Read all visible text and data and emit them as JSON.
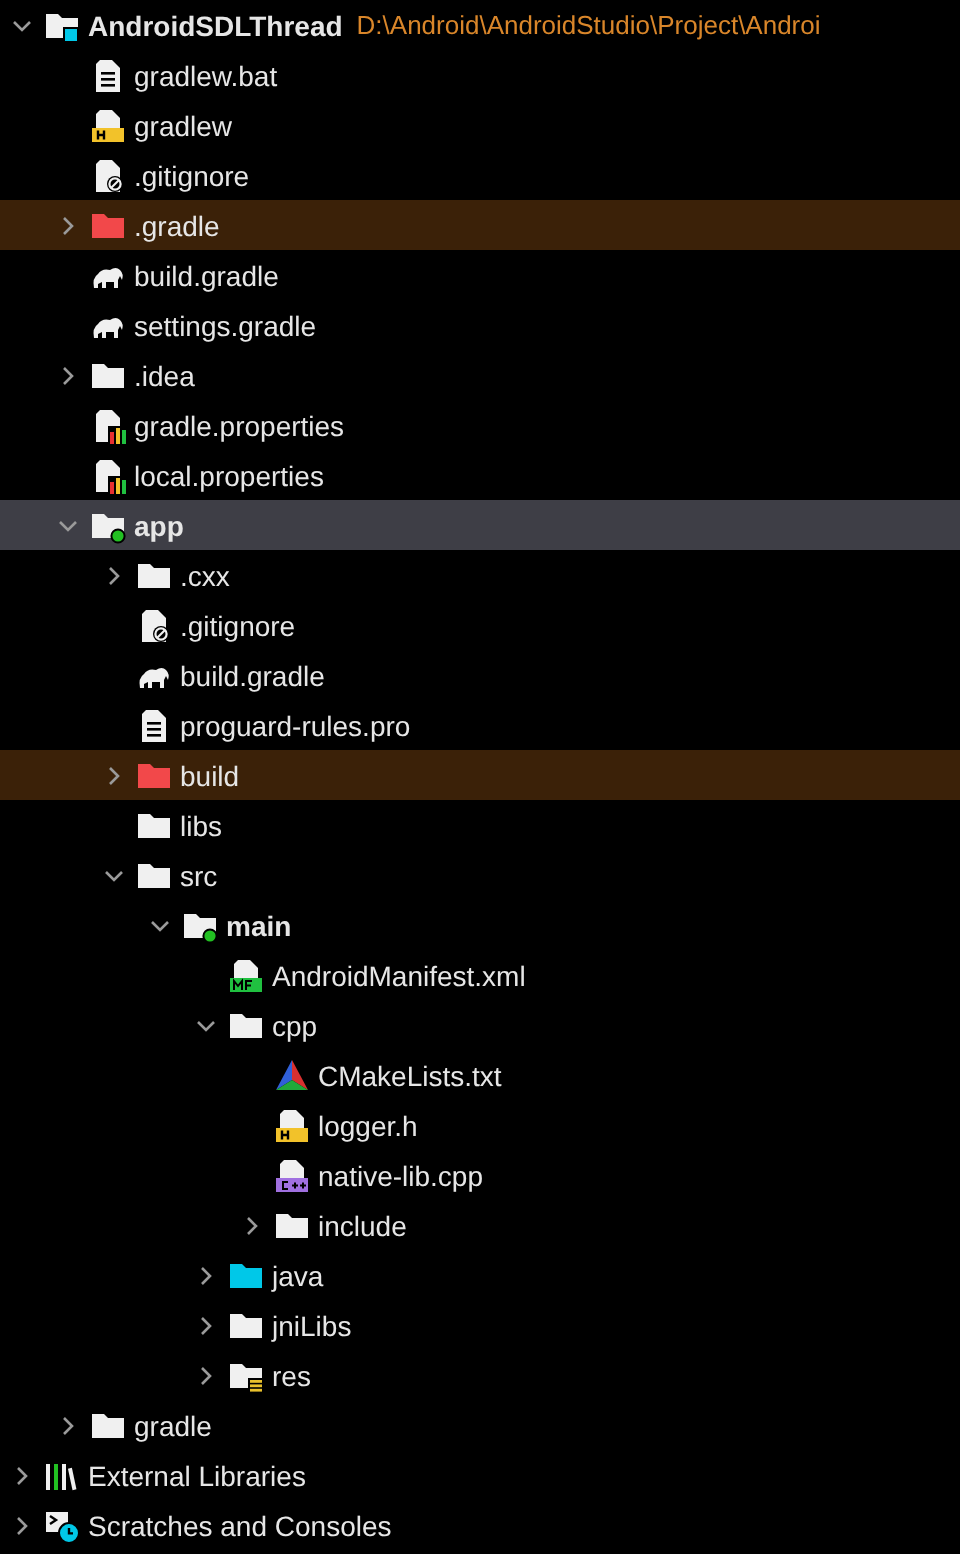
{
  "tree": [
    {
      "label": "AndroidSDLThread",
      "path": "D:\\Android\\AndroidStudio\\Project\\Androi",
      "kind": "project",
      "expanded": true,
      "selected": false,
      "excluded": false,
      "children": [
        {
          "label": "gradlew.bat",
          "kind": "text",
          "selected": false,
          "excluded": false
        },
        {
          "label": "gradlew",
          "kind": "shell",
          "selected": false,
          "excluded": false
        },
        {
          "label": ".gitignore",
          "kind": "ignore",
          "selected": false,
          "excluded": false
        },
        {
          "label": ".gradle",
          "kind": "folder",
          "expanded": false,
          "selected": false,
          "excluded": true
        },
        {
          "label": "build.gradle",
          "kind": "gradle",
          "selected": false,
          "excluded": false
        },
        {
          "label": "settings.gradle",
          "kind": "gradle",
          "selected": false,
          "excluded": false
        },
        {
          "label": ".idea",
          "kind": "folder",
          "expanded": false,
          "selected": false,
          "excluded": false
        },
        {
          "label": "gradle.properties",
          "kind": "properties",
          "selected": false,
          "excluded": false
        },
        {
          "label": "local.properties",
          "kind": "properties",
          "selected": false,
          "excluded": false
        },
        {
          "label": "app",
          "kind": "module",
          "expanded": true,
          "selected": true,
          "excluded": false,
          "children": [
            {
              "label": ".cxx",
              "kind": "folder",
              "expanded": false,
              "selected": false,
              "excluded": false
            },
            {
              "label": ".gitignore",
              "kind": "ignore",
              "selected": false,
              "excluded": false
            },
            {
              "label": "build.gradle",
              "kind": "gradle",
              "selected": false,
              "excluded": false
            },
            {
              "label": "proguard-rules.pro",
              "kind": "text",
              "selected": false,
              "excluded": false
            },
            {
              "label": "build",
              "kind": "folder",
              "expanded": false,
              "selected": false,
              "excluded": true
            },
            {
              "label": "libs",
              "kind": "folder",
              "selected": false,
              "excluded": false
            },
            {
              "label": "src",
              "kind": "folder",
              "expanded": true,
              "selected": false,
              "excluded": false,
              "children": [
                {
                  "label": "main",
                  "kind": "module",
                  "expanded": true,
                  "selected": false,
                  "excluded": false,
                  "children": [
                    {
                      "label": "AndroidManifest.xml",
                      "kind": "manifest",
                      "selected": false,
                      "excluded": false
                    },
                    {
                      "label": "cpp",
                      "kind": "folder",
                      "expanded": true,
                      "selected": false,
                      "excluded": false,
                      "children": [
                        {
                          "label": "CMakeLists.txt",
                          "kind": "cmake",
                          "selected": false,
                          "excluded": false
                        },
                        {
                          "label": "logger.h",
                          "kind": "header",
                          "selected": false,
                          "excluded": false
                        },
                        {
                          "label": "native-lib.cpp",
                          "kind": "cpp",
                          "selected": false,
                          "excluded": false
                        },
                        {
                          "label": "include",
                          "kind": "folder",
                          "expanded": false,
                          "selected": false,
                          "excluded": false
                        }
                      ]
                    },
                    {
                      "label": "java",
                      "kind": "source",
                      "expanded": false,
                      "selected": false,
                      "excluded": false
                    },
                    {
                      "label": "jniLibs",
                      "kind": "folder",
                      "expanded": false,
                      "selected": false,
                      "excluded": false
                    },
                    {
                      "label": "res",
                      "kind": "resources",
                      "expanded": false,
                      "selected": false,
                      "excluded": false
                    }
                  ]
                }
              ]
            }
          ]
        },
        {
          "label": "gradle",
          "kind": "folder",
          "expanded": false,
          "selected": false,
          "excluded": false
        }
      ]
    },
    {
      "label": "External Libraries",
      "kind": "libraries",
      "expanded": false,
      "selected": false,
      "excluded": false
    },
    {
      "label": "Scratches and Consoles",
      "kind": "scratches",
      "expanded": false,
      "selected": false,
      "excluded": false
    }
  ]
}
